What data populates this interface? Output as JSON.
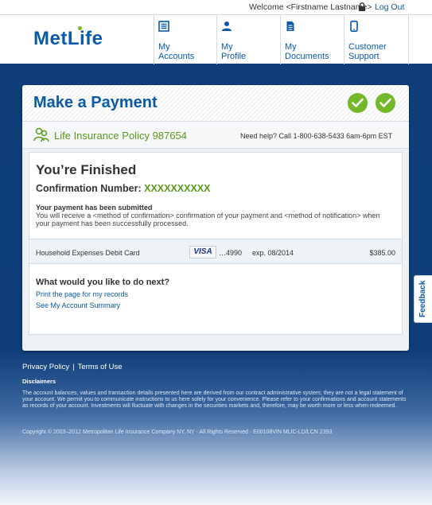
{
  "top_bar": {
    "welcome": "Welcome <Firstname Lastname>",
    "logout": "Log Out",
    "lock_icon": "lock-icon"
  },
  "header": {
    "logo": "MetLife",
    "nav": [
      {
        "label_line1": "My",
        "label_line2": "Accounts",
        "icon": "list-icon"
      },
      {
        "label_line1": "My",
        "label_line2": "Profile",
        "icon": "person-icon"
      },
      {
        "label_line1": "My",
        "label_line2": "Documents",
        "icon": "document-icon"
      },
      {
        "label_line1": "Customer",
        "label_line2": "Support",
        "icon": "phone-icon"
      }
    ]
  },
  "card": {
    "title": "Make a Payment",
    "policy": "Life Insurance Policy 987654",
    "help": "Need help? Call 1-800-638-5433 6am-6pm EST",
    "finished_title": "You’re Finished",
    "confirmation_label": "Confirmation Number: ",
    "confirmation_value": "XXXXXXXXXX",
    "submitted_title": "Your payment has been submitted",
    "submitted_body": "You will receive a <method of confirmation> confirmation of your payment and <method of notification> when your payment has been successfully processed.",
    "payment": {
      "name": "Household Expenses Debit Card",
      "card_brand": "VISA",
      "card_number": "…4990",
      "expiry": "exp. 08/2014",
      "amount": "$385.00"
    },
    "next_title": "What would you like to do next?",
    "next_links": [
      "Print the page for my records",
      "See My Account Summary"
    ]
  },
  "feedback": "Feedback",
  "footer": {
    "privacy": "Privacy Policy",
    "separator": "|",
    "terms": "Terms of Use",
    "disclaimers_title": "Disclaimers",
    "disclaimer_text": "The account balances, values and transaction details presented here are derived from our contract administrative system; they are not a legal statement of your account. We permit you to communicate instructions to us here solely for your convenience. Please refer to your confirmations and account statements as records of your account. Investments will fluctuate with changes in the securities markets and, therefore, may be worth more or less when redeemed.",
    "copyright": "Copyright © 2003–2012 Metropolitan Life Insurance Company NY, NY - All Rights Reserved - E00108VIN MLIC-LD/LCN 2393"
  },
  "colors": {
    "brand_blue": "#0b5aa8",
    "accent_green": "#72b828",
    "page_background": "#0e3d78"
  }
}
